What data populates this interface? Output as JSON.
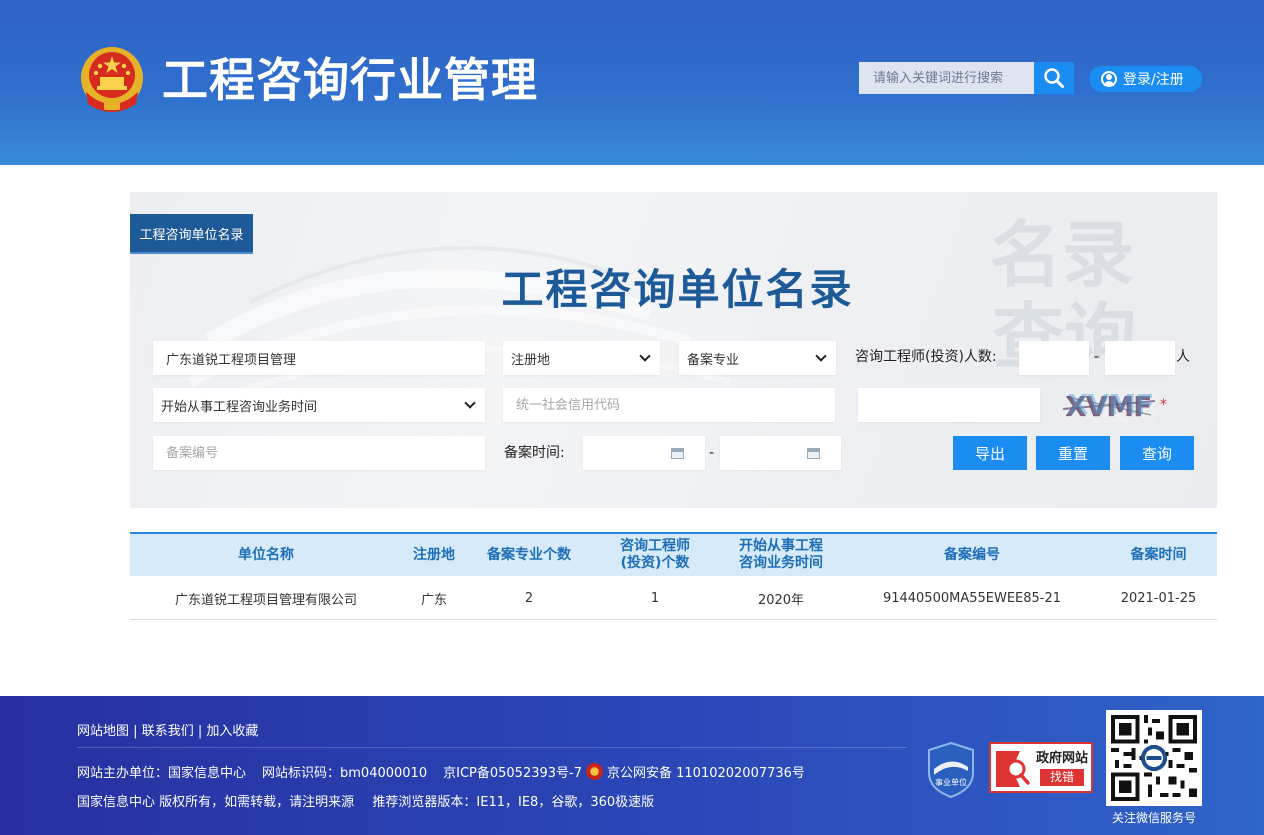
{
  "header": {
    "site_title": "工程咨询行业管理",
    "search_placeholder": "请输入关键词进行搜索",
    "login_label": "登录/注册"
  },
  "panel": {
    "tab_label": "工程咨询单位名录",
    "heading": "工程咨询单位名录",
    "watermark": [
      "名录",
      "查询"
    ],
    "company_name_value": "广东道锐工程项目管理",
    "registration_select": "注册地",
    "specialty_select": "备案专业",
    "engineer_count_label": "咨询工程师(投资)人数:",
    "range_dash": "-",
    "person_unit": "人",
    "start_time_select": "开始从事工程咨询业务时间",
    "credit_code_placeholder": "统一社会信用代码",
    "captcha_text": "XVMF",
    "required_mark": "*",
    "record_no_placeholder": "备案编号",
    "record_time_label": "备案时间:",
    "date_dash": "-",
    "export_label": "导出",
    "reset_label": "重置",
    "query_label": "查询"
  },
  "table": {
    "headers": {
      "name": "单位名称",
      "reg": "注册地",
      "spec_count": "备案专业个数",
      "eng_count_l1": "咨询工程师",
      "eng_count_l2": "(投资)个数",
      "start_l1": "开始从事工程",
      "start_l2": "咨询业务时间",
      "record_no": "备案编号",
      "record_time": "备案时间"
    },
    "rows": [
      {
        "name": "广东道锐工程项目管理有限公司",
        "reg": "广东",
        "spec_count": "2",
        "eng_count": "1",
        "start": "2020年",
        "record_no": "91440500MA55EWEE85-21",
        "record_time": "2021-01-25"
      }
    ]
  },
  "footer": {
    "links": [
      "网站地图",
      "联系我们",
      "加入收藏"
    ],
    "link_sep": "|",
    "host": "网站主办单位：国家信息中心",
    "site_id": "网站标识码：bm04000010",
    "icp": "京ICP备05052393号-7",
    "police": "京公网安备 11010202007736号",
    "copyright": "国家信息中心 版权所有，如需转载，请注明来源",
    "browser": "推荐浏览器版本：IE11，IE8，谷歌，360极速版",
    "badge_shiye": "事业单位",
    "badge_gov_l1": "政府网站",
    "badge_gov_l2": "找错",
    "qr_caption": "关注微信服务号"
  },
  "colors": {
    "header_blue": "#2f62c4",
    "accent_blue": "#1b8cf2",
    "heading_blue": "#1e5a97",
    "table_header_bg": "#d6eaf9",
    "footer_blue": "#2a3fae"
  }
}
